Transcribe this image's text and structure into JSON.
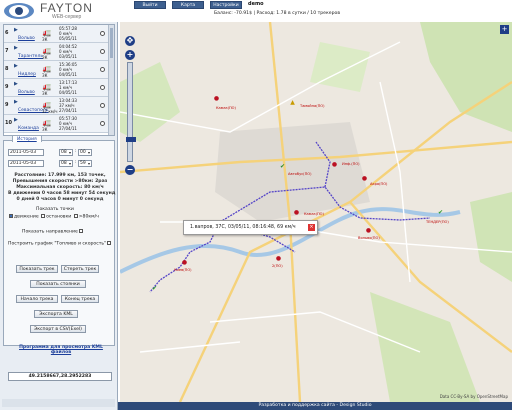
{
  "header": {
    "brand": "FAYTON",
    "subtitle": "WEB-сервер",
    "nav": [
      "Выйти",
      "Карта",
      "Настройки"
    ],
    "user": "demo",
    "balance": "Баланс: -70.91$ | Расход: 1.78 в сутки / 10 трекеров"
  },
  "vehicles": [
    {
      "num": "6",
      "name": "Вольво",
      "sub": "ЗК",
      "time": "05:57:28",
      "speed": "0 км/ч",
      "date": "05/05/11",
      "icon": "🚛"
    },
    {
      "num": "7",
      "name": "Тарантель",
      "sub": "ЗК",
      "time": "04:04:52",
      "speed": "0 км/ч",
      "date": "03/05/11",
      "icon": "🚛"
    },
    {
      "num": "8",
      "name": "Нидлер",
      "sub": "ЗК",
      "time": "15:36:05",
      "speed": "0 км/ч",
      "date": "04/05/11",
      "icon": "🚛"
    },
    {
      "num": "9",
      "name": "Вольво",
      "sub": "ЗК",
      "time": "13:17:13",
      "speed": "1 км/ч",
      "date": "04/05/11",
      "icon": "🚛"
    },
    {
      "num": "9",
      "name": "Севастополь",
      "sub": "37 км/ч",
      "time": "13:04:33",
      "speed": "37 км/ч",
      "date": "27/04/11",
      "icon": "🚛"
    },
    {
      "num": "10",
      "name": "Команда",
      "sub": "ЗК",
      "time": "05:57:30",
      "speed": "0 км/ч",
      "date": "27/04/11",
      "icon": "🚛"
    }
  ],
  "history": {
    "tab": "История",
    "date_from": "2011-05-03",
    "date_to": "2011-05-03",
    "h_from": "08",
    "m_from": "00",
    "h_to": "08",
    "m_to": "59",
    "stats": [
      "Расстояние: 17.999 км, 153 точек,",
      "Превышения скорости >80км: 2раз",
      "Максимальная скорость: 80 км/ч",
      "В движении 0 часов 58 минут 54 секунд",
      "0 дней 0 часов 0 минут 0 секунд"
    ],
    "show_points": "Показать точки",
    "opt_movement": "движение",
    "opt_stops": "остановки",
    "opt_speed": ">80км/ч",
    "show_direction": "Показать направление",
    "build_graph": "Построить график \"Топливо и скорость\"",
    "buttons": {
      "show_track": "Показать трек",
      "erase_track": "Стереть трек",
      "show_stops": "Показать стоянки",
      "track_start": "Начало трека",
      "track_end": "Конец трека",
      "export_kml": "Экспорта KML",
      "export_csv": "Экспорт в CSV(Exel)"
    },
    "kml_link": "Программа для просмотра KML файлов"
  },
  "coords": "49.2158667,28.2952283",
  "map": {
    "popup": "1.вапров, 37С, 03/05/11, 08:16:48, 69 км/ч",
    "zoom_in": "+",
    "zoom_out": "−",
    "attribution": "Data CC-By-SA by OpenStreetMap",
    "labels": [
      {
        "text": "Тамойпа(ПО)"
      },
      {
        "text": "Камаз(ПО)"
      },
      {
        "text": "Автобус(ПО)"
      },
      {
        "text": "Инф.(ПО)"
      },
      {
        "text": "Акра(ПО)"
      },
      {
        "text": "Камаз(ПО)"
      },
      {
        "text": "ТЕНДЕР(ПО)"
      },
      {
        "text": "Вольво(ПО)"
      },
      {
        "text": "2(ПО)"
      },
      {
        "text": "Киев(ПО)"
      }
    ]
  },
  "footer": "Разработка и поддержка сайта - Design Studio",
  "colors": {
    "accent": "#2e4a78",
    "track": "#5545c8",
    "button": "#3d5f8f"
  }
}
